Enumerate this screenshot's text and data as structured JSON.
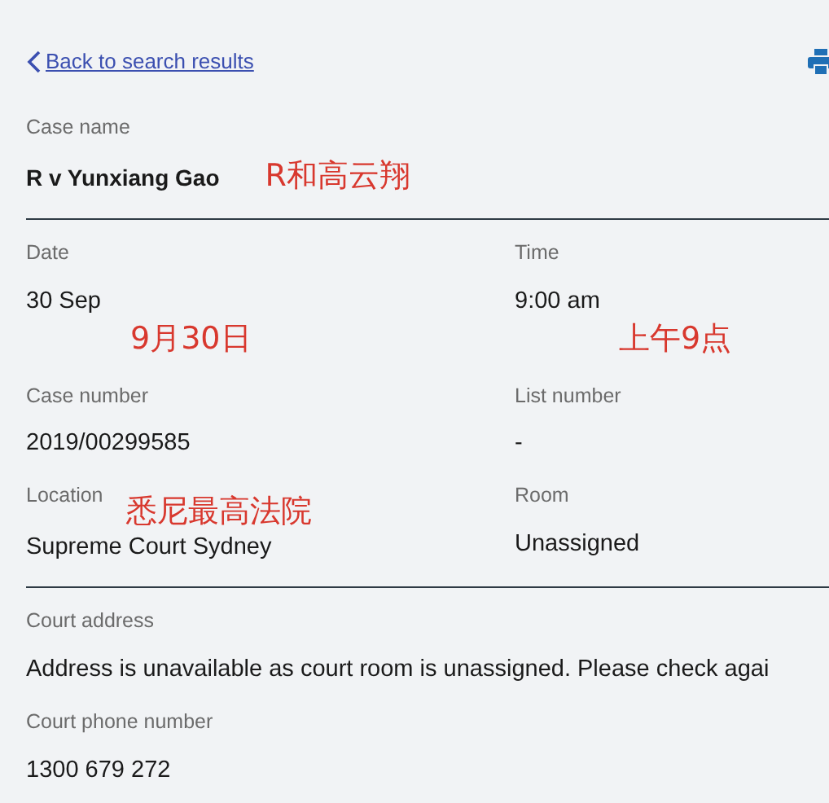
{
  "back_link": {
    "label": "Back to search results"
  },
  "sections": [
    {
      "divider": true,
      "rows": [
        [
          {
            "label": "Case name",
            "value": "R v Yunxiang Gao",
            "bold": true,
            "annotation": {
              "text": "R和高云翔",
              "kind": "after"
            }
          }
        ]
      ]
    },
    {
      "divider": true,
      "rows": [
        [
          {
            "label": "Date",
            "value": "30 Sep",
            "bold": false,
            "annotation": {
              "text": "9月30日",
              "kind": "below"
            }
          },
          {
            "label": "Time",
            "value": "9:00 am",
            "bold": false,
            "annotation": {
              "text": "上午9点",
              "kind": "below"
            }
          }
        ],
        [
          {
            "label": "Case number",
            "value": "2019/00299585",
            "bold": false
          },
          {
            "label": "List number",
            "value": "-",
            "bold": false
          }
        ],
        [
          {
            "label": "Location",
            "value": "Supreme Court Sydney",
            "bold": false,
            "annotation": {
              "text": "悉尼最高法院",
              "kind": "label"
            }
          },
          {
            "label": "Room",
            "value": "Unassigned",
            "bold": false
          }
        ]
      ]
    },
    {
      "divider": false,
      "rows": [
        [
          {
            "label": "Court address",
            "value": "Address is unavailable as court room is unassigned. Please check agai",
            "bold": false
          }
        ],
        [
          {
            "label": "Court phone number",
            "value": "1300 679 272",
            "bold": false
          }
        ]
      ]
    }
  ]
}
